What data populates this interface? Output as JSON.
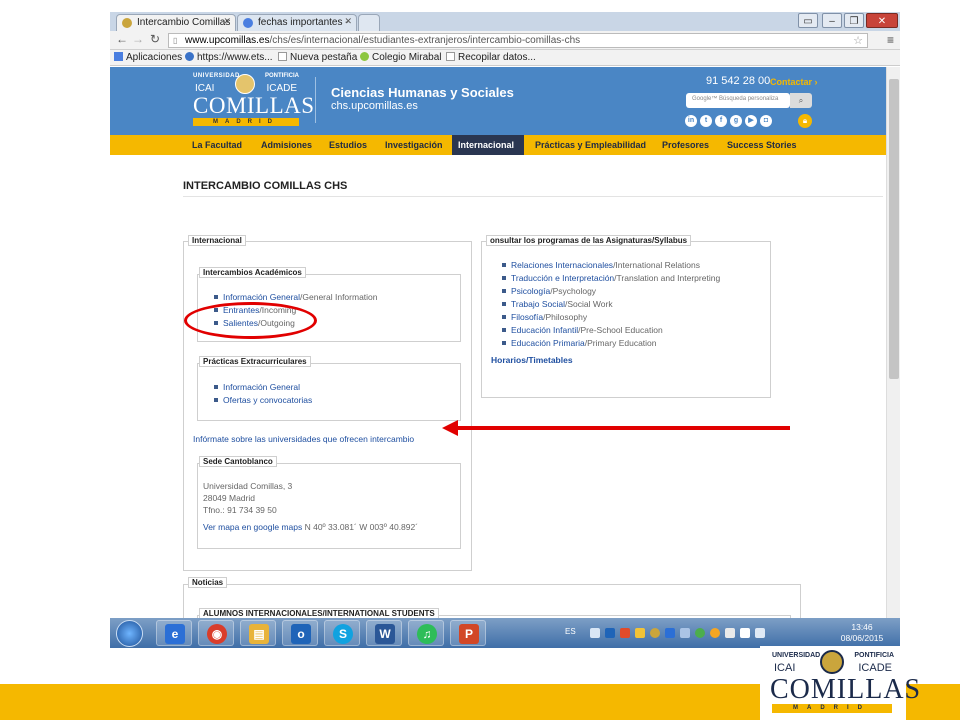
{
  "browser": {
    "tabs": [
      {
        "label": "Intercambio Comillas",
        "active": true
      },
      {
        "label": "fechas importantes -",
        "active": false
      }
    ],
    "url_prefix": "www.upcomillas.es",
    "url_path": "/chs/es/internacional/estudiantes-extranjeros/intercambio-comillas-chs",
    "bookmarks": [
      "Aplicaciones",
      "https://www.ets...",
      "Nueva pestaña",
      "Colegio Mirabal",
      "Recopilar datos..."
    ]
  },
  "site": {
    "logo": {
      "top_left": "UNIVERSIDAD",
      "top_right": "PONTIFICIA",
      "mid_left": "ICAI",
      "mid_right": "ICADE",
      "name": "COMILLAS",
      "city": "MADRID"
    },
    "title": "Ciencias Humanas y Sociales",
    "subtitle": "chs.upcomillas.es",
    "phone": "91 542 28 00",
    "contact": "Contactar ›",
    "search_placeholder": "Google™ Búsqueda personaliza",
    "nav": [
      "La Facultad",
      "Admisiones",
      "Estudios",
      "Investigación",
      "Internacional",
      "Prácticas y Empleabilidad",
      "Profesores",
      "Success Stories"
    ],
    "active_nav": "Internacional"
  },
  "page": {
    "heading": "INTERCAMBIO COMILLAS CHS",
    "internacional_legend": "Internacional",
    "academicos": {
      "legend": "Intercambios Académicos",
      "items": [
        {
          "es": "Información General",
          "en": "/General Information"
        },
        {
          "es": "Entrantes",
          "en": "/Incoming"
        },
        {
          "es": "Salientes",
          "en": "/Outgoing"
        }
      ]
    },
    "practicas": {
      "legend": "Prácticas Extracurriculares",
      "items": [
        "Información General",
        "Ofertas y convocatorias"
      ]
    },
    "universidades_link": "Infórmate sobre las universidades que ofrecen intercambio",
    "sede": {
      "legend": "Sede Cantoblanco",
      "lines": [
        "Universidad Comillas, 3",
        "28049 Madrid",
        "Tfno.: 91 734 39 50"
      ],
      "map_link": "Ver mapa en google maps",
      "coords": " N 40º 33.081´ W 003º 40.892´"
    },
    "syllabus": {
      "legend": "onsultar los programas de las Asignaturas/Syllabus",
      "items": [
        {
          "es": "Relaciones Internacionales",
          "en": "/International Relations"
        },
        {
          "es": "Traducción e Interpretación",
          "en": "/Translation and Interpreting"
        },
        {
          "es": "Psicología",
          "en": "/Psychology"
        },
        {
          "es": "Trabajo Social",
          "en": "/Social Work"
        },
        {
          "es": "Filosofía",
          "en": "/Philosophy"
        },
        {
          "es": "Educación Infantil",
          "en": "/Pre-School Education"
        },
        {
          "es": "Educación Primaria",
          "en": "/Primary Education"
        }
      ],
      "horarios": "Horarios/Timetables"
    },
    "noticias": {
      "legend": "Noticias",
      "sub_legend": "ALUMNOS INTERNACIONALES/INTERNATIONAL STUDENTS"
    }
  },
  "taskbar": {
    "apps": [
      "e",
      "◉",
      "▤",
      "o",
      "S",
      "W",
      "♫",
      "P"
    ],
    "lang": "ES",
    "time": "13:46",
    "date": "08/06/2015"
  },
  "slide_logo": {
    "top_left": "UNIVERSIDAD",
    "top_right": "PONTIFICIA",
    "mid_left": "ICAI",
    "mid_right": "ICADE",
    "name": "COMILLAS",
    "city": "MADRID"
  },
  "colors": {
    "accent_yellow": "#f5b800",
    "header_blue": "#4a86c5",
    "annotation_red": "#e10000",
    "link_blue": "#1f4fa0"
  }
}
